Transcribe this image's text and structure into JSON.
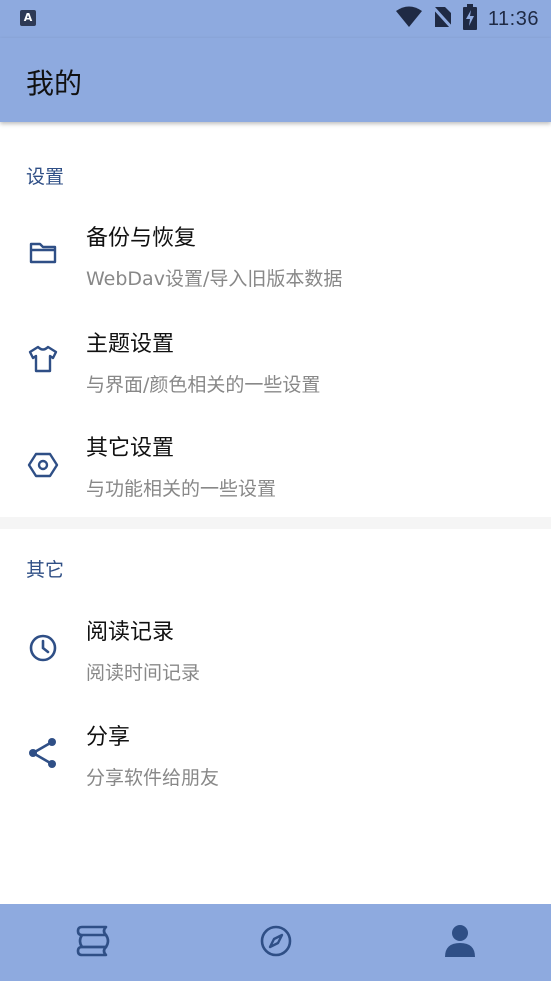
{
  "status_bar": {
    "time": "11:36",
    "app_icon_letter": "A",
    "icons": [
      "wifi-icon",
      "no-sim-icon",
      "battery-charging-icon"
    ]
  },
  "app_bar": {
    "title": "我的"
  },
  "sections": [
    {
      "header": "设置",
      "items": [
        {
          "title": "备份与恢复",
          "subtitle": "WebDav设置/导入旧版本数据",
          "icon": "folder-icon"
        },
        {
          "title": "主题设置",
          "subtitle": "与界面/颜色相关的一些设置",
          "icon": "tshirt-icon"
        },
        {
          "title": "其它设置",
          "subtitle": "与功能相关的一些设置",
          "icon": "hexagon-settings-icon"
        }
      ]
    },
    {
      "header": "其它",
      "items": [
        {
          "title": "阅读记录",
          "subtitle": "阅读时间记录",
          "icon": "clock-icon"
        },
        {
          "title": "分享",
          "subtitle": "分享软件给朋友",
          "icon": "share-icon"
        }
      ]
    }
  ],
  "bottom_nav": {
    "tabs": [
      {
        "icon": "bookshelf-icon",
        "selected": false
      },
      {
        "icon": "compass-icon",
        "selected": false
      },
      {
        "icon": "person-icon",
        "selected": true
      }
    ]
  },
  "colors": {
    "primary": "#8eaadf",
    "accent_icon": "#2f4f86",
    "section_header": "#2f4f86",
    "subtitle": "#888888"
  }
}
